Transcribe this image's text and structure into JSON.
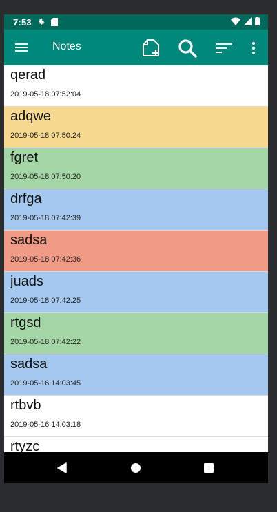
{
  "status_bar": {
    "time": "7:53",
    "icons": [
      "gear-icon",
      "sd-card-icon",
      "wifi-icon",
      "signal-icon",
      "battery-icon"
    ]
  },
  "app_bar": {
    "title": "Notes",
    "icons": [
      "hamburger-menu-icon",
      "new-note-icon",
      "search-icon",
      "sort-icon",
      "more-options-icon"
    ]
  },
  "colors": {
    "status_bar": "#00695c",
    "app_bar": "#00897b",
    "white": "#ffffff",
    "yellow": "#f7d98f",
    "green": "#a5d6a7",
    "blue": "#a4c8ee",
    "red": "#f19a86"
  },
  "notes": [
    {
      "title": "qerad",
      "date": "2019-05-18 07:52:04",
      "color": "#ffffff"
    },
    {
      "title": "adqwe",
      "date": "2019-05-18 07:50:24",
      "color": "#f7d98f"
    },
    {
      "title": "fgret",
      "date": "2019-05-18 07:50:20",
      "color": "#a5d6a7"
    },
    {
      "title": "drfga",
      "date": "2019-05-18 07:42:39",
      "color": "#a4c8ee"
    },
    {
      "title": "sadsa",
      "date": "2019-05-18 07:42:36",
      "color": "#f19a86"
    },
    {
      "title": "juads",
      "date": "2019-05-18 07:42:25",
      "color": "#a4c8ee"
    },
    {
      "title": "rtgsd",
      "date": "2019-05-18 07:42:22",
      "color": "#a5d6a7"
    },
    {
      "title": "sadsa",
      "date": "2019-05-16 14:03:45",
      "color": "#a4c8ee"
    },
    {
      "title": "rtbvb",
      "date": "2019-05-16 14:03:18",
      "color": "#ffffff"
    },
    {
      "title": "rtyzc",
      "date": "",
      "color": "#ffffff"
    }
  ],
  "nav_bar": {
    "icons": [
      "back-icon",
      "home-icon",
      "recents-icon"
    ]
  }
}
